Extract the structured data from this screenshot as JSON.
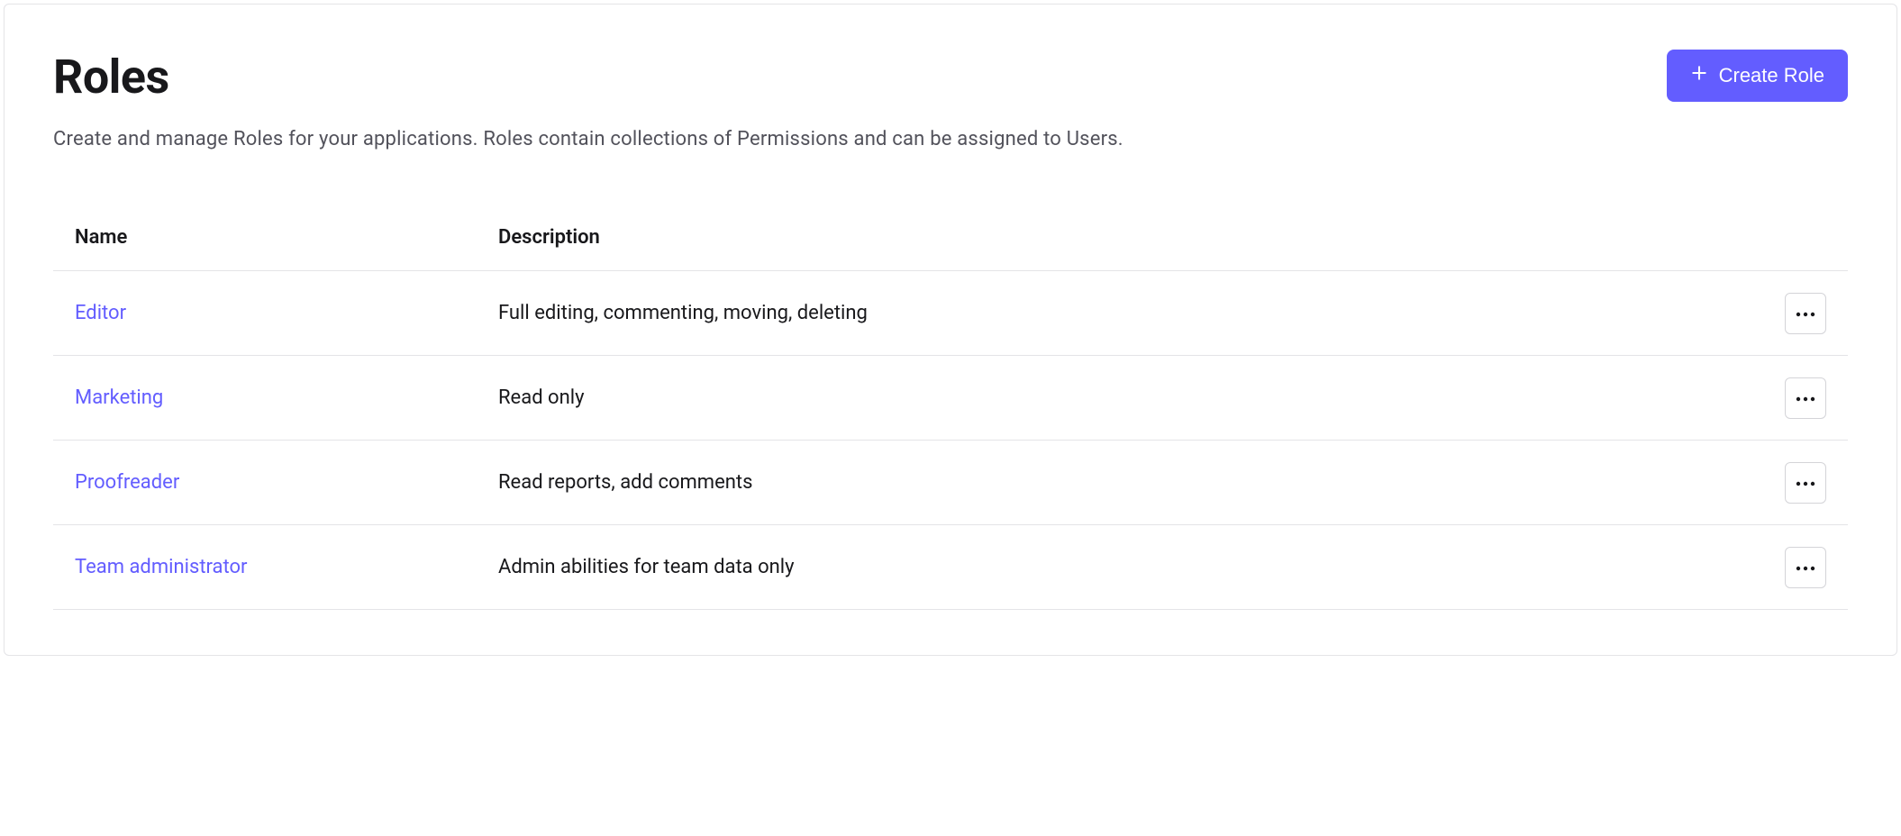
{
  "header": {
    "title": "Roles",
    "subtitle": "Create and manage Roles for your applications. Roles contain collections of Permissions and can be assigned to Users.",
    "create_button_label": "Create Role"
  },
  "table": {
    "columns": {
      "name": "Name",
      "description": "Description"
    },
    "rows": [
      {
        "name": "Editor",
        "description": "Full editing, commenting, moving, deleting"
      },
      {
        "name": "Marketing",
        "description": "Read only"
      },
      {
        "name": "Proofreader",
        "description": "Read reports, add comments"
      },
      {
        "name": "Team administrator",
        "description": "Admin abilities for team data only"
      }
    ]
  },
  "colors": {
    "accent": "#635dff"
  }
}
